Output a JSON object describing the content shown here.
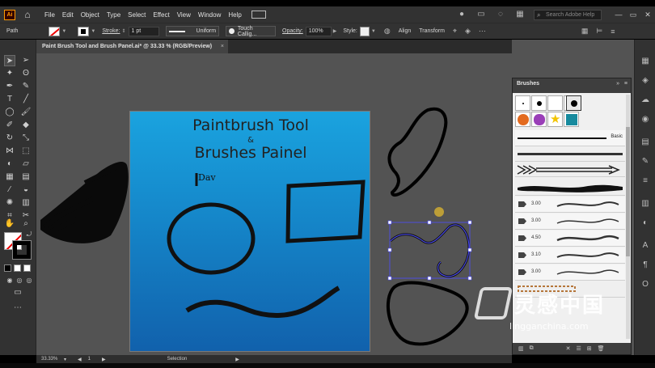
{
  "app": {
    "logo": "Ai",
    "menu": [
      "File",
      "Edit",
      "Object",
      "Type",
      "Select",
      "Effect",
      "View",
      "Window",
      "Help"
    ],
    "search_placeholder": "Search Adobe Help"
  },
  "control": {
    "selection_type": "Path",
    "stroke_label": "Stroke:",
    "stroke_weight": "1 pt",
    "profile": "Uniform",
    "brush": "Touch Callig...",
    "opacity_label": "Opacity:",
    "opacity": "100%",
    "style_label": "Style:",
    "align": "Align",
    "transform": "Transform"
  },
  "document": {
    "tab_title": "Paint Brush Tool and Brush Panel.ai* @ 33.33 % (RGB/Preview)",
    "close": "×"
  },
  "artboard": {
    "title_line1": "Paintbrush Tool",
    "amp": "&",
    "title_line2": "Brushes Painel",
    "signature": "Dav"
  },
  "status": {
    "zoom": "33.33%",
    "page": "1",
    "tool": "Selection"
  },
  "brushes": {
    "panel_title": "Brushes",
    "collapse": "»",
    "menu": "≡",
    "basic_label": "Basic",
    "rows": [
      "3.00",
      "3.00",
      "4.50",
      "3.10",
      "3.00"
    ]
  },
  "watermark": {
    "cn": "灵感中国",
    "url": "lingganchina.com"
  },
  "colors": {
    "accent": "#ff9a00",
    "canvas": "#535353",
    "artboard_top": "#1aa3df",
    "artboard_bottom": "#1161ac",
    "selection": "#4b4bff"
  }
}
